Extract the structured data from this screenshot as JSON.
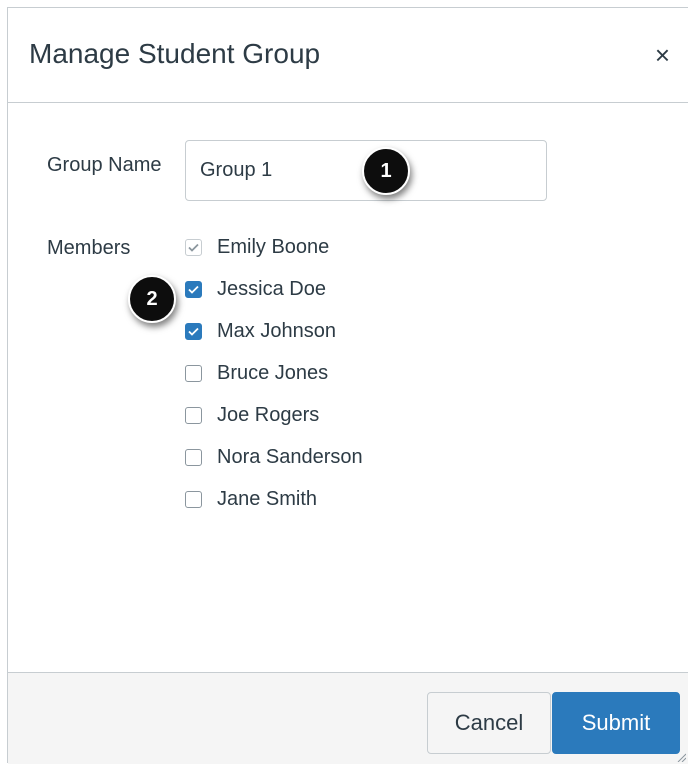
{
  "dialog": {
    "title": "Manage Student Group",
    "close_label": "×"
  },
  "form": {
    "group_name_label": "Group Name",
    "group_name_value": "Group 1",
    "members_label": "Members"
  },
  "members": [
    {
      "name": "Emily Boone",
      "checked": true,
      "disabled": true
    },
    {
      "name": "Jessica Doe",
      "checked": true,
      "disabled": false
    },
    {
      "name": "Max Johnson",
      "checked": true,
      "disabled": false
    },
    {
      "name": "Bruce Jones",
      "checked": false,
      "disabled": false
    },
    {
      "name": "Joe Rogers",
      "checked": false,
      "disabled": false
    },
    {
      "name": "Nora Sanderson",
      "checked": false,
      "disabled": false
    },
    {
      "name": "Jane Smith",
      "checked": false,
      "disabled": false
    }
  ],
  "callouts": {
    "one": "1",
    "two": "2"
  },
  "footer": {
    "cancel_label": "Cancel",
    "submit_label": "Submit"
  },
  "colors": {
    "accent": "#2b7abc",
    "text": "#2d3b45",
    "border": "#c7cdd1",
    "footer_bg": "#f5f5f5"
  }
}
